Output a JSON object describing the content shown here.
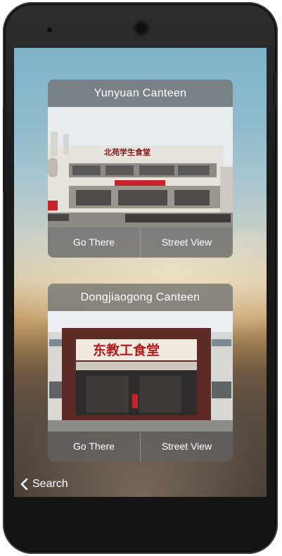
{
  "cards": [
    {
      "title": "Yunyuan Canteen",
      "sign": "北苑学生食堂",
      "go_label": "Go There",
      "street_label": "Street View"
    },
    {
      "title": "Dongjiaogong Canteen",
      "sign": "东教工食堂",
      "go_label": "Go There",
      "street_label": "Street View"
    }
  ],
  "nav": {
    "back_label": "Search",
    "back_icon": "chevron-left-icon"
  },
  "colors": {
    "banner_red": "#c8232b",
    "sign_red": "#b01c1c",
    "frame_maroon": "#5e2a26"
  }
}
